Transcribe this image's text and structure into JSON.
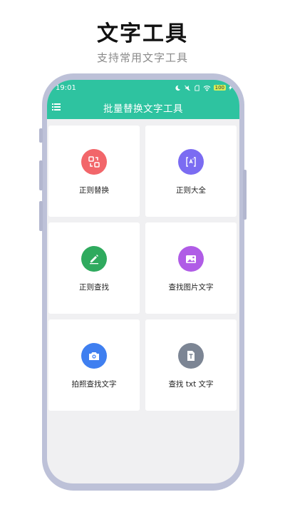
{
  "hero": {
    "title": "文字工具",
    "subtitle": "支持常用文字工具"
  },
  "statusbar": {
    "time": "19:01",
    "battery": "100"
  },
  "appbar": {
    "title": "批量替换文字工具"
  },
  "cards": [
    {
      "label": "正则替换",
      "icon": "swap-icon",
      "color": "#f2666a"
    },
    {
      "label": "正则大全",
      "icon": "regex-icon",
      "color": "#7b6cf2"
    },
    {
      "label": "正则查找",
      "icon": "pencil-icon",
      "color": "#2faa5e"
    },
    {
      "label": "查找图片文字",
      "icon": "image-icon",
      "color": "#b05ce6"
    },
    {
      "label": "拍照查找文字",
      "icon": "camera-icon",
      "color": "#3f7ff0"
    },
    {
      "label": "查找 txt 文字",
      "icon": "text-file-icon",
      "color": "#7c8594"
    }
  ]
}
